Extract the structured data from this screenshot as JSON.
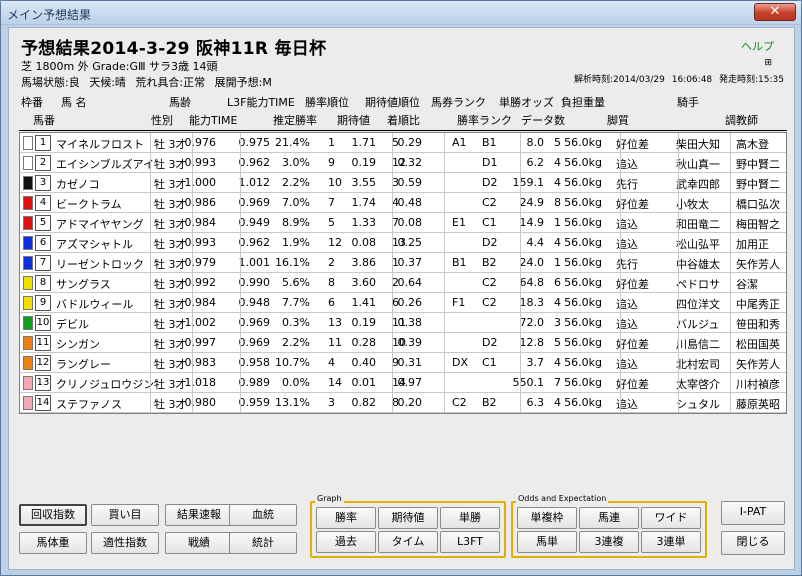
{
  "window": {
    "title": "メイン予想結果",
    "close": "✕"
  },
  "header": {
    "title": "予想結果2014-3-29 阪神11R 毎日杯",
    "course": "芝 1800m 外 Grade:GⅢ サラ3歳 14頭",
    "conditions": "馬場状態:良 天候:晴 荒れ具合:正常 展開予想:M",
    "help": "ヘルプ",
    "mini": "⊞",
    "analysis_time": "解析時刻:2014/03/29 16:06:48",
    "post_time": "発走時刻:15:35"
  },
  "columns_top": [
    "枠番",
    "馬 名",
    "馬齢",
    "L3F能力TIME",
    "勝率順位",
    "期待値順位",
    "馬券ランク",
    "単勝オッズ",
    "負担重量",
    "騎手"
  ],
  "columns_bottom": [
    "馬番",
    "性別",
    "能力TIME",
    "推定勝率",
    "期待値",
    "着順比",
    "勝率ランク",
    "データ数",
    "脚質",
    "調教師"
  ],
  "rows": [
    {
      "gate": "1",
      "gc": "#ffffff",
      "tc": "#000",
      "num": "1",
      "name": "マイネルフロスト",
      "sex": "牡 3才",
      "t1": "0.976",
      "t2": "0.975",
      "rate": "21.4%",
      "rank": "1",
      "ev": "1.71",
      "evr": "5",
      "ratio": "0.29",
      "b1": "A1",
      "b2": "B1",
      "odds": "8.0",
      "data": "5",
      "wt": "56.0kg",
      "style": "好位差",
      "jockey": "柴田大知",
      "trainer": "高木登"
    },
    {
      "gate": "1",
      "gc": "#ffffff",
      "tc": "#000",
      "num": "2",
      "name": "エイシンブルズアイ",
      "sex": "牡 3才",
      "t1": "0.993",
      "t2": "0.962",
      "rate": "3.0%",
      "rank": "9",
      "ev": "0.19",
      "evr": "12",
      "ratio": "0.32",
      "b1": "",
      "b2": "D1",
      "odds": "6.2",
      "data": "4",
      "wt": "56.0kg",
      "style": "追込",
      "jockey": "秋山真一",
      "trainer": "野中賢二"
    },
    {
      "gate": "2",
      "gc": "#111111",
      "tc": "#fff",
      "num": "3",
      "name": "カゼノコ",
      "sex": "牡 3才",
      "t1": "1.000",
      "t2": "1.012",
      "rate": "2.2%",
      "rank": "10",
      "ev": "3.55",
      "evr": "3",
      "ratio": "0.59",
      "b1": "",
      "b2": "D2",
      "odds": "159.1",
      "data": "4",
      "wt": "56.0kg",
      "style": "先行",
      "jockey": "武幸四郎",
      "trainer": "野中賢二"
    },
    {
      "gate": "3",
      "gc": "#e01010",
      "tc": "#fff",
      "num": "4",
      "name": "ビークトラム",
      "sex": "牡 3才",
      "t1": "0.986",
      "t2": "0.969",
      "rate": "7.0%",
      "rank": "7",
      "ev": "1.74",
      "evr": "4",
      "ratio": "0.48",
      "b1": "",
      "b2": "C2",
      "odds": "24.9",
      "data": "8",
      "wt": "56.0kg",
      "style": "好位差",
      "jockey": "小牧太",
      "trainer": "橋口弘次"
    },
    {
      "gate": "3",
      "gc": "#e01010",
      "tc": "#fff",
      "num": "5",
      "name": "アドマイヤヤング",
      "sex": "牡 3才",
      "t1": "0.984",
      "t2": "0.949",
      "rate": "8.9%",
      "rank": "5",
      "ev": "1.33",
      "evr": "7",
      "ratio": "0.08",
      "b1": "E1",
      "b2": "C1",
      "odds": "14.9",
      "data": "1",
      "wt": "56.0kg",
      "style": "追込",
      "jockey": "和田竜二",
      "trainer": "梅田智之"
    },
    {
      "gate": "4",
      "gc": "#1030e0",
      "tc": "#fff",
      "num": "6",
      "name": "アズマシャトル",
      "sex": "牡 3才",
      "t1": "0.993",
      "t2": "0.962",
      "rate": "1.9%",
      "rank": "12",
      "ev": "0.08",
      "evr": "13",
      "ratio": "0.25",
      "b1": "",
      "b2": "D2",
      "odds": "4.4",
      "data": "4",
      "wt": "56.0kg",
      "style": "追込",
      "jockey": "松山弘平",
      "trainer": "加用正"
    },
    {
      "gate": "4",
      "gc": "#1030e0",
      "tc": "#fff",
      "num": "7",
      "name": "リーゼントロック",
      "sex": "牡 3才",
      "t1": "0.979",
      "t2": "1.001",
      "rate": "16.1%",
      "rank": "2",
      "ev": "3.86",
      "evr": "1",
      "ratio": "0.37",
      "b1": "B1",
      "b2": "B2",
      "odds": "24.0",
      "data": "1",
      "wt": "56.0kg",
      "style": "先行",
      "jockey": "中谷雄太",
      "trainer": "矢作芳人"
    },
    {
      "gate": "5",
      "gc": "#f0e000",
      "tc": "#000",
      "num": "8",
      "name": "サングラス",
      "sex": "牡 3才",
      "t1": "0.992",
      "t2": "0.990",
      "rate": "5.6%",
      "rank": "8",
      "ev": "3.60",
      "evr": "2",
      "ratio": "0.64",
      "b1": "",
      "b2": "C2",
      "odds": "64.8",
      "data": "6",
      "wt": "56.0kg",
      "style": "好位差",
      "jockey": "ペドロサ",
      "trainer": "谷潔"
    },
    {
      "gate": "5",
      "gc": "#f0e000",
      "tc": "#000",
      "num": "9",
      "name": "バドルウィール",
      "sex": "牡 3才",
      "t1": "0.984",
      "t2": "0.948",
      "rate": "7.7%",
      "rank": "6",
      "ev": "1.41",
      "evr": "6",
      "ratio": "0.26",
      "b1": "F1",
      "b2": "C2",
      "odds": "18.3",
      "data": "4",
      "wt": "56.0kg",
      "style": "追込",
      "jockey": "四位洋文",
      "trainer": "中尾秀正"
    },
    {
      "gate": "6",
      "gc": "#10a020",
      "tc": "#fff",
      "num": "10",
      "name": "デビル",
      "sex": "牡 3才",
      "t1": "1.002",
      "t2": "0.969",
      "rate": "0.3%",
      "rank": "13",
      "ev": "0.19",
      "evr": "11",
      "ratio": "0.38",
      "b1": "",
      "b2": "",
      "odds": "72.0",
      "data": "3",
      "wt": "56.0kg",
      "style": "追込",
      "jockey": "バルジュ",
      "trainer": "笹田和秀"
    },
    {
      "gate": "7",
      "gc": "#f08010",
      "tc": "#000",
      "num": "11",
      "name": "シンガン",
      "sex": "牡 3才",
      "t1": "0.997",
      "t2": "0.969",
      "rate": "2.2%",
      "rank": "11",
      "ev": "0.28",
      "evr": "10",
      "ratio": "0.39",
      "b1": "",
      "b2": "D2",
      "odds": "12.8",
      "data": "5",
      "wt": "56.0kg",
      "style": "好位差",
      "jockey": "川島信二",
      "trainer": "松田国英"
    },
    {
      "gate": "7",
      "gc": "#f08010",
      "tc": "#000",
      "num": "12",
      "name": "ラングレー",
      "sex": "牡 3才",
      "t1": "0.983",
      "t2": "0.958",
      "rate": "10.7%",
      "rank": "4",
      "ev": "0.40",
      "evr": "9",
      "ratio": "0.31",
      "b1": "DX",
      "b2": "C1",
      "odds": "3.7",
      "data": "4",
      "wt": "56.0kg",
      "style": "追込",
      "jockey": "北村宏司",
      "trainer": "矢作芳人"
    },
    {
      "gate": "8",
      "gc": "#f4a8b4",
      "tc": "#000",
      "num": "13",
      "name": "クリノジュロウジン",
      "sex": "牡 3才",
      "t1": "1.018",
      "t2": "0.989",
      "rate": "0.0%",
      "rank": "14",
      "ev": "0.01",
      "evr": "14",
      "ratio": "0.97",
      "b1": "",
      "b2": "",
      "odds": "550.1",
      "data": "7",
      "wt": "56.0kg",
      "style": "好位差",
      "jockey": "太宰啓介",
      "trainer": "川村禎彦"
    },
    {
      "gate": "8",
      "gc": "#f4a8b4",
      "tc": "#000",
      "num": "14",
      "name": "ステファノス",
      "sex": "牡 3才",
      "t1": "0.980",
      "t2": "0.959",
      "rate": "13.1%",
      "rank": "3",
      "ev": "0.82",
      "evr": "8",
      "ratio": "0.20",
      "b1": "C2",
      "b2": "B2",
      "odds": "6.3",
      "data": "4",
      "wt": "56.0kg",
      "style": "追込",
      "jockey": "シュタル",
      "trainer": "藤原英昭"
    }
  ],
  "buttons": {
    "recovery": "回収指数",
    "kaime": "買い目",
    "result": "結果速報",
    "blood": "血統",
    "weight": "馬体重",
    "aptitude": "適性指数",
    "record": "戦績",
    "stats": "統計",
    "graph_label": "Graph",
    "win_rate": "勝率",
    "expected": "期待値",
    "tansho": "単勝",
    "past": "過去",
    "time": "タイム",
    "l3ft": "L3FT",
    "odds_label": "Odds and Expectation",
    "fukushowaku": "単複枠",
    "umaren": "馬連",
    "wide": "ワイド",
    "umatan": "馬単",
    "sanrenpuku": "3連複",
    "sanrentan": "3連単",
    "ipat": "I-PAT",
    "close": "閉じる"
  }
}
